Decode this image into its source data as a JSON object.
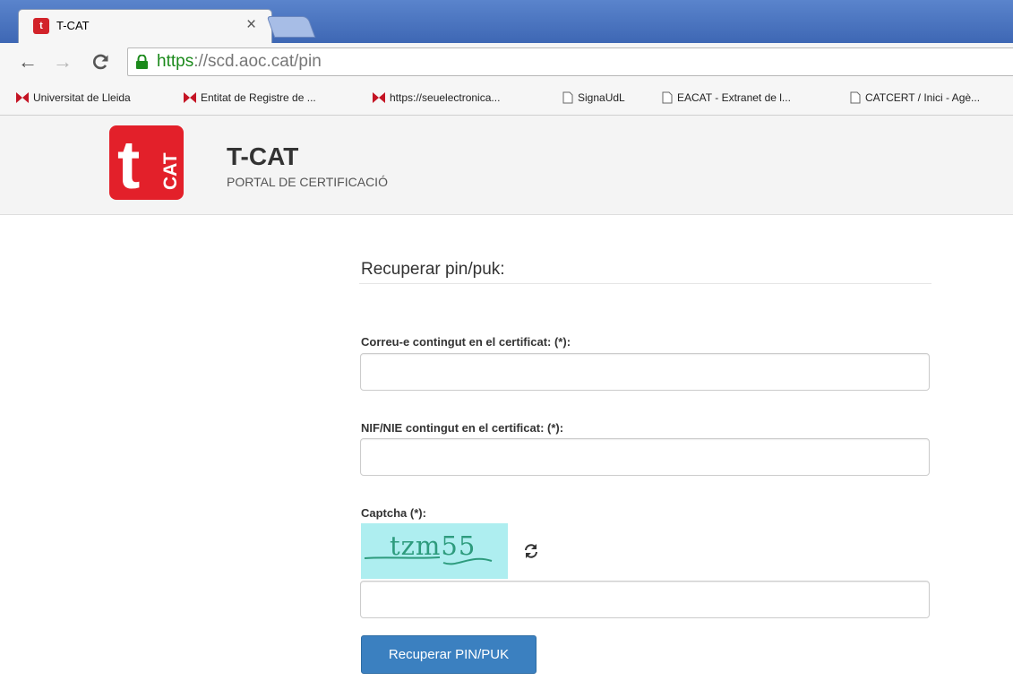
{
  "browser": {
    "tab_title": "T-CAT",
    "tab_favicon_text": "t",
    "close_symbol": "×",
    "url_scheme": "https",
    "url_rest": "://scd.aoc.cat/pin",
    "bookmarks": [
      {
        "label": "Universitat de Lleida",
        "icon": "red-bowtie-icon"
      },
      {
        "label": "Entitat de Registre de ...",
        "icon": "red-bowtie-icon"
      },
      {
        "label": "https://seuelectronica...",
        "icon": "red-bowtie-icon"
      },
      {
        "label": "SignaUdL",
        "icon": "page-icon"
      },
      {
        "label": "EACAT - Extranet de l...",
        "icon": "page-icon"
      },
      {
        "label": "CATCERT / Inici - Agè...",
        "icon": "page-icon"
      }
    ]
  },
  "site": {
    "logo_letter": "t",
    "logo_vertical": "CAT",
    "title": "T-CAT",
    "subtitle": "PORTAL DE CERTIFICACIÓ"
  },
  "form": {
    "section_title": "Recuperar pin/puk:",
    "email_label": "Correu-e contingut en el certificat: (*):",
    "email_value": "",
    "nif_label": "NIF/NIE contingut en el certificat: (*):",
    "nif_value": "",
    "captcha_label": "Captcha (*):",
    "captcha_text": "tzm55",
    "captcha_value": "",
    "submit_label": "Recuperar PIN/PUK"
  },
  "colors": {
    "brand_red": "#e3202a",
    "button_blue": "#3b80c0",
    "captcha_bg": "#aeeef0",
    "url_green": "#1c8a1c"
  }
}
